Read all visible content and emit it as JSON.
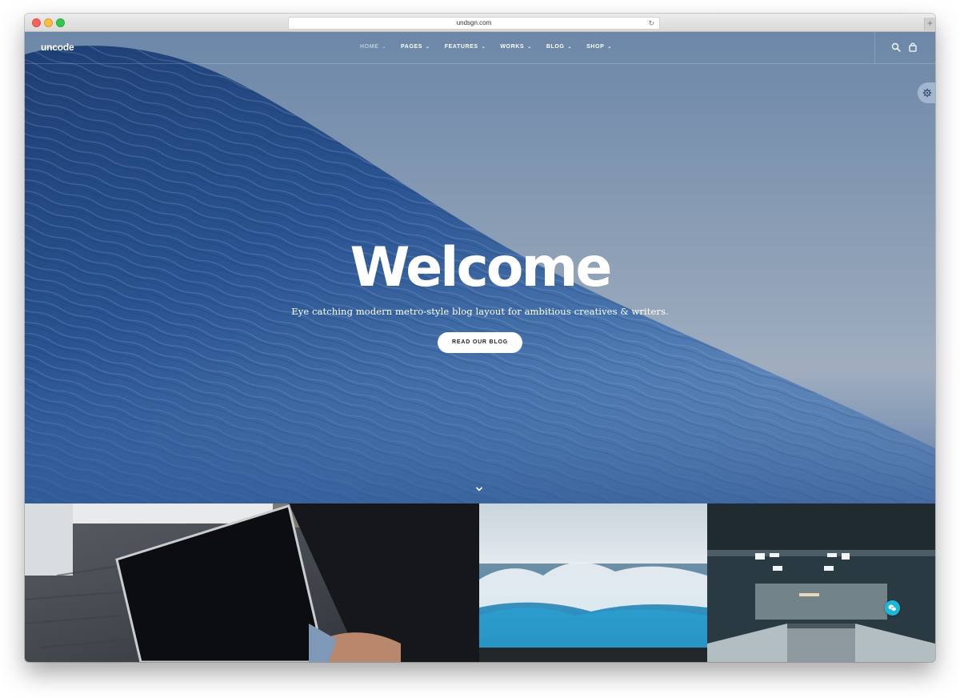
{
  "browser": {
    "url": "undsgn.com",
    "reload_icon": "reload-icon",
    "new_tab_label": "+"
  },
  "nav": {
    "logo": "uncode",
    "items": [
      {
        "label": "HOME",
        "active": true
      },
      {
        "label": "PAGES",
        "active": false
      },
      {
        "label": "FEATURES",
        "active": false
      },
      {
        "label": "WORKS",
        "active": false
      },
      {
        "label": "BLOG",
        "active": false
      },
      {
        "label": "SHOP",
        "active": false
      }
    ],
    "chevron": "⌄",
    "icons": [
      "search-icon",
      "shopping-bag-icon"
    ]
  },
  "side_panel": {
    "icon": "gear-icon"
  },
  "hero": {
    "title": "Welcome",
    "subtitle": "Eye catching modern metro-style blog layout for ambitious creatives & writers.",
    "button_label": "READ OUR BLOG",
    "scroll_icon": "chevron-down-icon"
  },
  "gallery": {
    "tiles": [
      {
        "subject": "laptop-on-lap"
      },
      {
        "subject": "ocean-wave"
      },
      {
        "subject": "concrete-corridor"
      }
    ]
  },
  "chat": {
    "icon": "chat-bubble-icon",
    "color": "#1ab8d8"
  }
}
